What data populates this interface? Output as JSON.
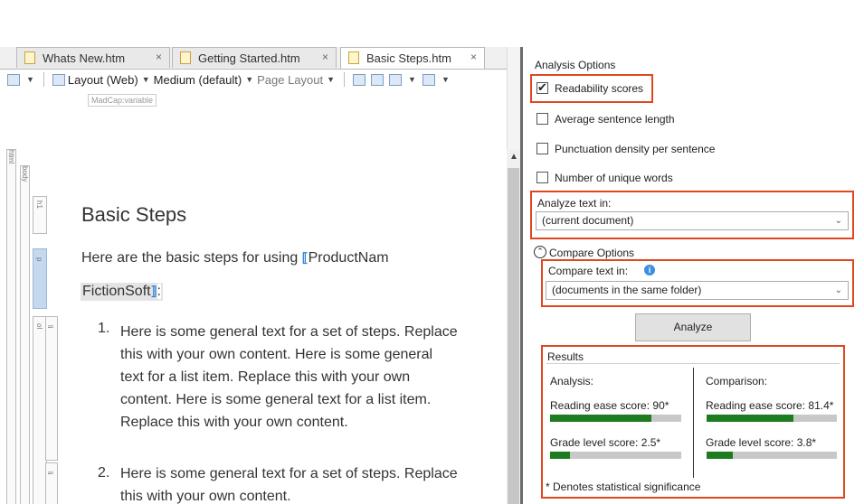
{
  "tabs": [
    {
      "label": "Whats New.htm",
      "close": "×"
    },
    {
      "label": "Getting Started.htm",
      "close": "×"
    },
    {
      "label": "Basic Steps.htm",
      "close": "×"
    }
  ],
  "toolbar": {
    "layout": "Layout (Web)",
    "medium": "Medium (default)",
    "page_layout": "Page Layout"
  },
  "editor": {
    "variable_tag": "MadCap:variable",
    "structure": {
      "html": "html",
      "body": "body",
      "h1": "h1",
      "p": "p",
      "ol": "ol",
      "li": "li"
    },
    "heading": "Basic Steps",
    "intro": "Here are the basic steps for using",
    "variable_name": "ProductNam",
    "variable_value": "FictionSoft",
    "colon": ":",
    "list": [
      {
        "num": "1.",
        "lines": [
          "Here is some general text for a set of steps. Replace",
          "this with your own content. Here is some general",
          "text for a list item. Replace this with your own",
          "content. Here is some general text for a list item.",
          "Replace this with your own content."
        ]
      },
      {
        "num": "2.",
        "lines": [
          "Here is some general text for a set of steps. Replace",
          "this with your own content."
        ]
      }
    ]
  },
  "panel": {
    "title": "Analysis Options",
    "options": [
      {
        "label": "Readability scores",
        "checked": true
      },
      {
        "label": "Average sentence length",
        "checked": false
      },
      {
        "label": "Punctuation density per sentence",
        "checked": false
      },
      {
        "label": "Number of unique words",
        "checked": false
      }
    ],
    "analyze_in_label": "Analyze text in:",
    "analyze_in_value": "(current document)",
    "compare_options_label": "Compare Options",
    "compare_in_label": "Compare text in:",
    "compare_in_value": "(documents in the same folder)",
    "analyze_button": "Analyze",
    "results": {
      "title": "Results",
      "analysis_header": "Analysis:",
      "comparison_header": "Comparison:",
      "analysis": {
        "reading_ease": "Reading ease score: 90*",
        "reading_ease_fraction": 0.77,
        "grade_level": "Grade level score: 2.5*",
        "grade_level_fraction": 0.15
      },
      "comparison": {
        "reading_ease": "Reading ease score: 81.4*",
        "reading_ease_fraction": 0.67,
        "grade_level": "Grade level score: 3.8*",
        "grade_level_fraction": 0.2
      },
      "footnote": "* Denotes statistical significance"
    }
  },
  "colors": {
    "highlight": "#e0471f",
    "bar_fill": "#1d7c1d",
    "bar_track": "#c8c8c8",
    "info": "#3b8fe0"
  }
}
